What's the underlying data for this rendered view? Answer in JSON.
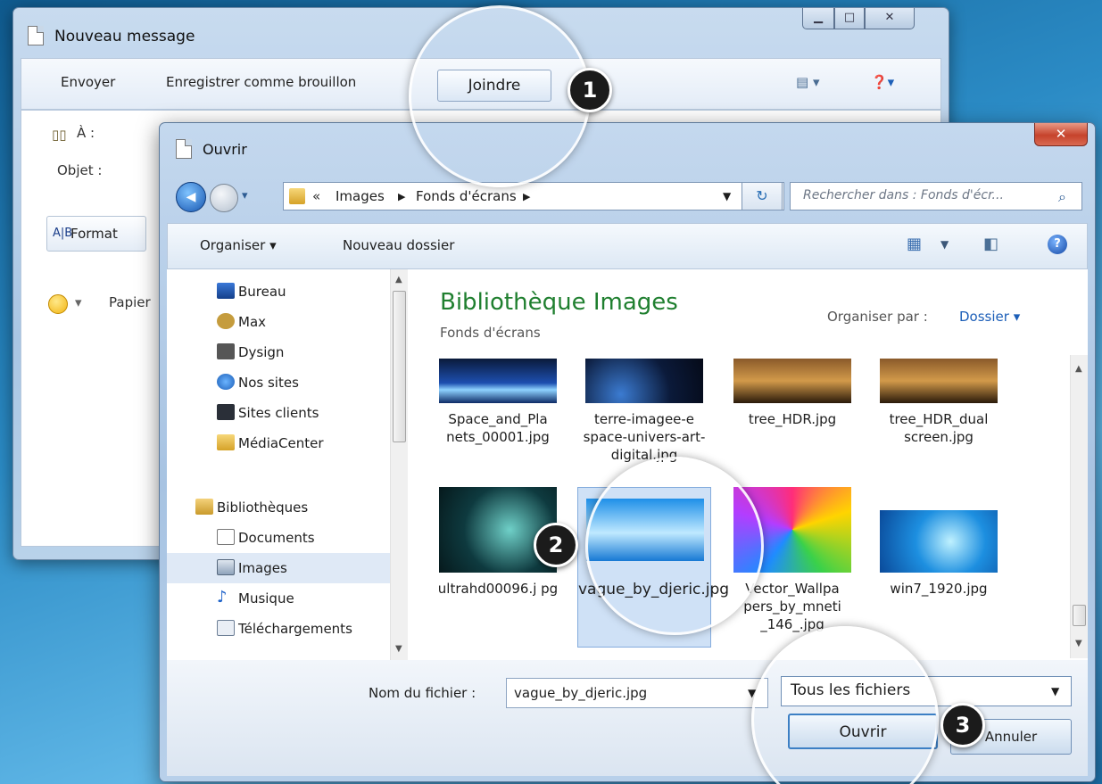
{
  "message_window": {
    "title": "Nouveau message",
    "toolbar": {
      "send": "Envoyer",
      "save_draft": "Enregistrer comme brouillon",
      "attach": "Joindre"
    },
    "to_label": "À :",
    "subject_label": "Objet :",
    "format_label": "Format",
    "paper_label": "Papier"
  },
  "open_dialog": {
    "title": "Ouvrir",
    "breadcrumb": [
      "Images",
      "Fonds d'écrans"
    ],
    "search_placeholder": "Rechercher dans : Fonds d'écr...",
    "toolbar": {
      "organize": "Organiser ▾",
      "new_folder": "Nouveau dossier"
    },
    "nav": [
      {
        "label": "Bureau",
        "icon": "desktop-icon"
      },
      {
        "label": "Max",
        "icon": "user-icon"
      },
      {
        "label": "Dysign",
        "icon": "folder-icon"
      },
      {
        "label": "Nos sites",
        "icon": "globe-icon"
      },
      {
        "label": "Sites clients",
        "icon": "folder-icon"
      },
      {
        "label": "MédiaCenter",
        "icon": "folder-icon"
      },
      {
        "label": "Bibliothèques",
        "icon": "library-icon"
      },
      {
        "label": "Documents",
        "icon": "documents-icon"
      },
      {
        "label": "Images",
        "icon": "images-icon",
        "selected": true
      },
      {
        "label": "Musique",
        "icon": "music-icon"
      },
      {
        "label": "Téléchargements",
        "icon": "download-icon"
      }
    ],
    "library_title": "Bibliothèque Images",
    "library_subtitle": "Fonds d'écrans",
    "arrange_label": "Organiser par :",
    "arrange_value": "Dossier ▾",
    "files": [
      {
        "name": "Space_and_Pla nets_00001.jpg"
      },
      {
        "name": "terre-imagee-e space-univers-art-digital.jpg"
      },
      {
        "name": "tree_HDR.jpg"
      },
      {
        "name": "tree_HDR_dual screen.jpg"
      },
      {
        "name": "ultrahd00096.j pg"
      },
      {
        "name": "vague_by_djeric.jpg",
        "selected": true
      },
      {
        "name": "Vector_Wallpa pers_by_mneti _146_.jpg"
      },
      {
        "name": "win7_1920.jpg"
      }
    ],
    "filename_label": "Nom du fichier :",
    "filename_value": "vague_by_djeric.jpg",
    "filetype_value": "Tous les fichiers",
    "open_button": "Ouvrir",
    "cancel_button": "Annuler"
  },
  "callouts": [
    "1",
    "2",
    "3"
  ]
}
